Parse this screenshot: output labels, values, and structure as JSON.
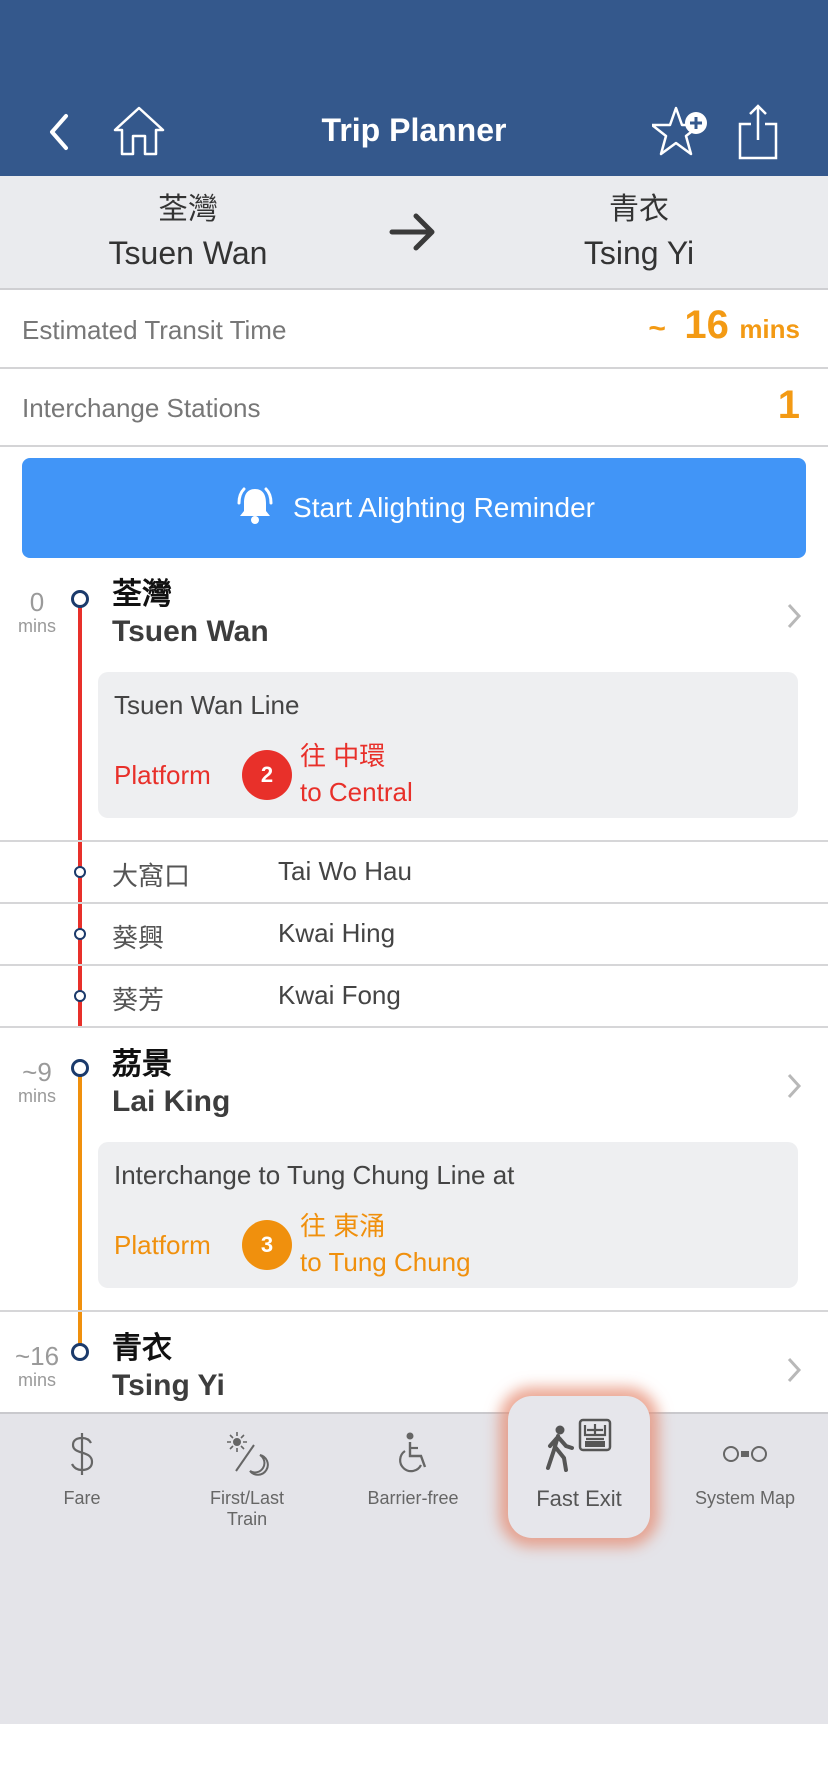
{
  "header": {
    "title": "Trip Planner",
    "back_icon": "chevron-left-icon",
    "home_icon": "home-icon",
    "favorite_icon": "star-add-icon",
    "share_icon": "share-icon"
  },
  "route": {
    "from": {
      "zh": "荃灣",
      "en": "Tsuen Wan"
    },
    "to": {
      "zh": "青衣",
      "en": "Tsing Yi"
    }
  },
  "summary": {
    "transit_time_label": "Estimated Transit Time",
    "transit_time_prefix": "~",
    "transit_time_value": "16",
    "transit_time_unit": "mins",
    "interchange_label": "Interchange Stations",
    "interchange_value": "1"
  },
  "reminder_button": {
    "label": "Start Alighting Reminder",
    "icon": "bell-icon"
  },
  "colors": {
    "header": "#34588c",
    "accent_orange": "#f39a14",
    "tsuen_wan_line": "#e8302a",
    "tung_chung_line": "#f0900d",
    "button_blue": "#4195f7"
  },
  "timeline": {
    "stops": [
      {
        "time": "0",
        "unit": "mins",
        "zh": "荃灣",
        "en": "Tsuen Wan",
        "card": {
          "title": "Tsuen Wan Line",
          "platform_label": "Platform",
          "platform_number": "2",
          "dest_zh": "往 中環",
          "dest_en": "to Central"
        }
      },
      {
        "time": "~9",
        "unit": "mins",
        "zh": "茘景",
        "en": "Lai King",
        "card": {
          "title": "Interchange to Tung Chung Line at",
          "platform_label": "Platform",
          "platform_number": "3",
          "dest_zh": "往 東涌",
          "dest_en": "to Tung Chung"
        }
      },
      {
        "time": "~16",
        "unit": "mins",
        "zh": "青衣",
        "en": "Tsing Yi"
      }
    ],
    "intermediate": [
      {
        "zh": "大窩口",
        "en": "Tai Wo Hau"
      },
      {
        "zh": "葵興",
        "en": "Kwai Hing"
      },
      {
        "zh": "葵芳",
        "en": "Kwai Fong"
      }
    ]
  },
  "toolbar": {
    "items": [
      {
        "label": "Fare",
        "icon": "dollar-icon"
      },
      {
        "label_line1": "First/Last",
        "label_line2": "Train",
        "icon": "sun-moon-icon"
      },
      {
        "label": "Barrier-free",
        "icon": "wheelchair-icon"
      },
      {
        "label": "Fast Exit",
        "icon": "fast-exit-icon",
        "highlighted": true
      },
      {
        "label": "System Map",
        "icon": "system-map-icon"
      }
    ]
  }
}
